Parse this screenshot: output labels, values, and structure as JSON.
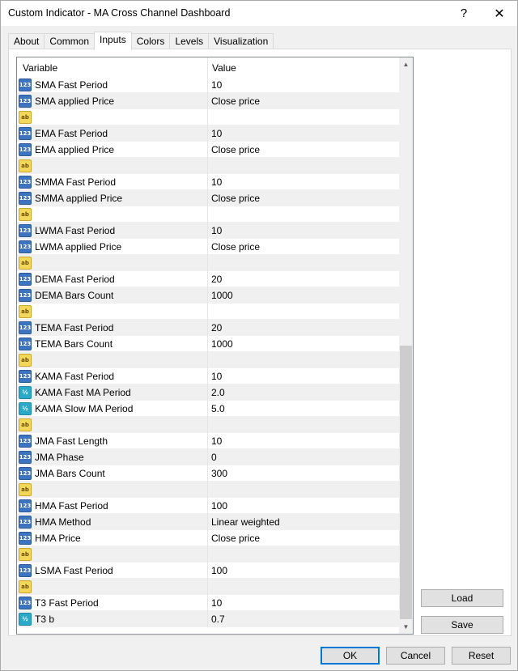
{
  "window": {
    "title": "Custom Indicator - MA Cross Channel Dashboard",
    "help_label": "?",
    "close_label": "✕"
  },
  "tabs": [
    {
      "label": "About"
    },
    {
      "label": "Common"
    },
    {
      "label": "Inputs",
      "active": true
    },
    {
      "label": "Colors"
    },
    {
      "label": "Levels"
    },
    {
      "label": "Visualization"
    }
  ],
  "grid": {
    "col_variable": "Variable",
    "col_value": "Value",
    "rows": [
      {
        "type": "num",
        "icon": "123",
        "variable": "SMA Fast Period",
        "value": "10"
      },
      {
        "type": "num",
        "icon": "123",
        "variable": "SMA applied Price",
        "value": "Close price"
      },
      {
        "type": "str",
        "icon": "ab",
        "variable": "",
        "value": ""
      },
      {
        "type": "num",
        "icon": "123",
        "variable": "EMA Fast Period",
        "value": "10"
      },
      {
        "type": "num",
        "icon": "123",
        "variable": "EMA applied Price",
        "value": "Close price"
      },
      {
        "type": "str",
        "icon": "ab",
        "variable": "",
        "value": ""
      },
      {
        "type": "num",
        "icon": "123",
        "variable": "SMMA Fast Period",
        "value": "10"
      },
      {
        "type": "num",
        "icon": "123",
        "variable": "SMMA applied Price",
        "value": "Close price"
      },
      {
        "type": "str",
        "icon": "ab",
        "variable": "",
        "value": ""
      },
      {
        "type": "num",
        "icon": "123",
        "variable": "LWMA Fast Period",
        "value": "10"
      },
      {
        "type": "num",
        "icon": "123",
        "variable": "LWMA applied Price",
        "value": "Close price"
      },
      {
        "type": "str",
        "icon": "ab",
        "variable": "",
        "value": ""
      },
      {
        "type": "num",
        "icon": "123",
        "variable": "DEMA Fast Period",
        "value": "20"
      },
      {
        "type": "num",
        "icon": "123",
        "variable": "DEMA Bars Count",
        "value": "1000"
      },
      {
        "type": "str",
        "icon": "ab",
        "variable": "",
        "value": ""
      },
      {
        "type": "num",
        "icon": "123",
        "variable": "TEMA Fast Period",
        "value": "20"
      },
      {
        "type": "num",
        "icon": "123",
        "variable": "TEMA Bars Count",
        "value": "1000"
      },
      {
        "type": "str",
        "icon": "ab",
        "variable": "",
        "value": ""
      },
      {
        "type": "num",
        "icon": "123",
        "variable": "KAMA Fast Period",
        "value": "10"
      },
      {
        "type": "dbl",
        "icon": "½",
        "variable": "KAMA Fast MA Period",
        "value": "2.0"
      },
      {
        "type": "dbl",
        "icon": "½",
        "variable": "KAMA Slow MA Period",
        "value": "5.0"
      },
      {
        "type": "str",
        "icon": "ab",
        "variable": "",
        "value": ""
      },
      {
        "type": "num",
        "icon": "123",
        "variable": "JMA Fast Length",
        "value": "10"
      },
      {
        "type": "num",
        "icon": "123",
        "variable": "JMA Phase",
        "value": "0"
      },
      {
        "type": "num",
        "icon": "123",
        "variable": "JMA Bars Count",
        "value": "300"
      },
      {
        "type": "str",
        "icon": "ab",
        "variable": "",
        "value": ""
      },
      {
        "type": "num",
        "icon": "123",
        "variable": "HMA Fast Period",
        "value": "100"
      },
      {
        "type": "num",
        "icon": "123",
        "variable": "HMA Method",
        "value": "Linear weighted"
      },
      {
        "type": "num",
        "icon": "123",
        "variable": "HMA Price",
        "value": "Close price"
      },
      {
        "type": "str",
        "icon": "ab",
        "variable": "",
        "value": ""
      },
      {
        "type": "num",
        "icon": "123",
        "variable": "LSMA Fast Period",
        "value": "100"
      },
      {
        "type": "str",
        "icon": "ab",
        "variable": "",
        "value": ""
      },
      {
        "type": "num",
        "icon": "123",
        "variable": "T3 Fast Period",
        "value": "10"
      },
      {
        "type": "dbl",
        "icon": "½",
        "variable": "T3 b",
        "value": "0.7"
      }
    ]
  },
  "buttons": {
    "load": "Load",
    "save": "Save",
    "ok": "OK",
    "cancel": "Cancel",
    "reset": "Reset"
  },
  "scrollbar": {
    "up_glyph": "▲",
    "down_glyph": "▼"
  }
}
